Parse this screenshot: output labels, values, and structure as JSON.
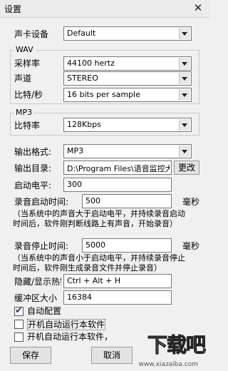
{
  "window": {
    "title": "设置",
    "close_icon": "close-icon"
  },
  "soundcard": {
    "label": "声卡设备",
    "value": "Default"
  },
  "wav": {
    "group_title": "WAV",
    "sample_rate_label": "采样率",
    "sample_rate_value": "44100 hertz",
    "channel_label": "声道",
    "channel_value": "STEREO",
    "bits_label": "比特/秒",
    "bits_value": "16 bits per sample"
  },
  "mp3": {
    "group_title": "MP3",
    "bitrate_label": "比特率",
    "bitrate_value": "128Kbps"
  },
  "output": {
    "format_label": "输出格式:",
    "format_value": "MP3",
    "dir_label": "输出目录:",
    "dir_value": "D:\\Program Files\\语音监控大",
    "change_label": "更改"
  },
  "start": {
    "level_label": "启动电平:",
    "level_value": "300",
    "time_label": "录音启动时间:",
    "time_value": "500",
    "time_unit": "毫秒",
    "note_line1": "（当系统中的声音大于启动电平，并持续录音启动",
    "note_line2": "时间后，软件刚判断线路上有声音，开始录音）"
  },
  "stop": {
    "time_label": "录音停止时间:",
    "time_value": "5000",
    "time_unit": "毫秒",
    "note_line1": "（当系统中的声音小于启动电平，并持续录音停止",
    "note_line2": "时间后，软件刚生成录音文件并停止录音）"
  },
  "hotkey": {
    "label": "隐藏/显示热键",
    "value": "Ctrl + Alt + H"
  },
  "buffer": {
    "label": "缓冲区大小",
    "value": "16384"
  },
  "options": {
    "auto_config_label": "自动配置",
    "autorun1_label": "开机自动运行本软件",
    "autorun2_label": "开机自动运行本软件，"
  },
  "buttons": {
    "save_label": "保存",
    "cancel_label": "取消"
  },
  "watermark": {
    "main": "下载吧",
    "sub": "www.xiazaiba.com"
  }
}
